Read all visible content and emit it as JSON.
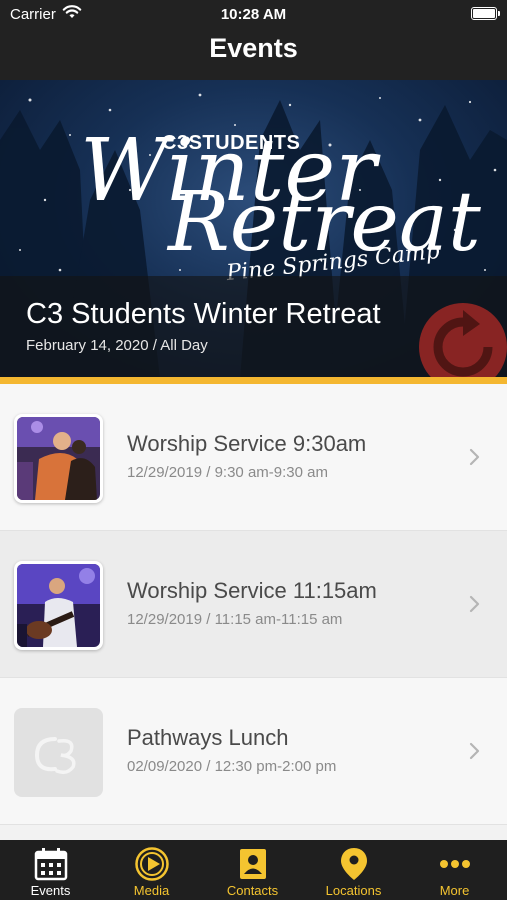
{
  "status_bar": {
    "carrier": "Carrier",
    "time": "10:28 AM"
  },
  "nav": {
    "title": "Events"
  },
  "hero": {
    "title": "C3 Students Winter Retreat",
    "subtitle": "February 14, 2020 / All Day",
    "art_text": {
      "brand": "C3STUDENTS",
      "word1": "Winter",
      "word2": "Retreat",
      "place": "Pine Springs Camp"
    }
  },
  "events": [
    {
      "title": "Worship Service 9:30am",
      "subtitle": "12/29/2019 / 9:30 am-9:30 am",
      "thumbnail": "photo-people-hugging"
    },
    {
      "title": "Worship Service 11:15am",
      "subtitle": "12/29/2019 / 11:15 am-11:15 am",
      "thumbnail": "photo-guitarist"
    },
    {
      "title": "Pathways Lunch",
      "subtitle": "02/09/2020 / 12:30 pm-2:00 pm",
      "thumbnail": "c3-logo-placeholder"
    }
  ],
  "tabs": [
    {
      "label": "Events",
      "icon": "calendar-icon"
    },
    {
      "label": "Media",
      "icon": "play-circle-icon"
    },
    {
      "label": "Contacts",
      "icon": "contact-card-icon"
    },
    {
      "label": "Locations",
      "icon": "map-pin-icon"
    },
    {
      "label": "More",
      "icon": "more-dots-icon"
    }
  ],
  "colors": {
    "accent": "#f4b731",
    "tab_icon": "#f4c430",
    "bar_bg": "#222222"
  }
}
